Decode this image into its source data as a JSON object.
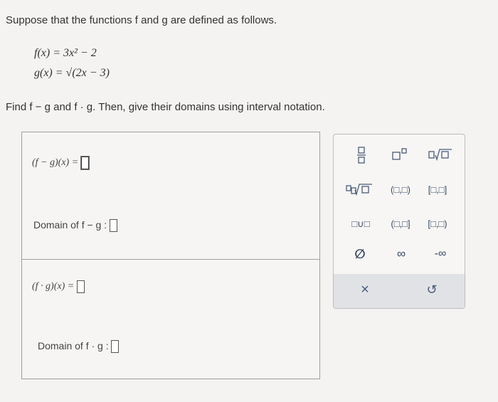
{
  "prompt": "Suppose that the functions f and g are defined as follows.",
  "functions": {
    "f_def": "f(x) = 3x² − 2",
    "g_def": "g(x) = √(2x − 3)"
  },
  "instruction": "Find f − g and f · g. Then, give their domains using interval notation.",
  "answers": {
    "diff_label": "(f − g)(x) =",
    "diff_domain_label": "Domain of f − g :",
    "prod_label": "(f · g)(x) =",
    "prod_domain_label": "Domain of f · g :"
  },
  "keypad": {
    "open_open": "(□,□)",
    "closed_closed": "[□,□]",
    "union": "□∪□",
    "open_closed": "(□,□]",
    "closed_open": "[□,□)",
    "empty_set": "∅",
    "infinity": "∞",
    "neg_infinity": "-∞",
    "clear": "×",
    "undo": "↺"
  }
}
